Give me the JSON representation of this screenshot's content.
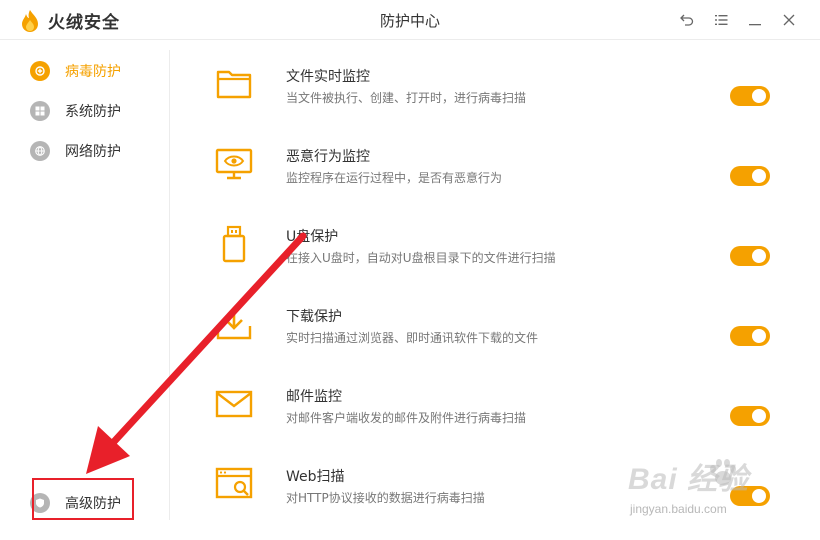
{
  "app": {
    "name": "火绒安全",
    "window_title": "防护中心"
  },
  "colors": {
    "accent": "#f5a100",
    "highlight": "#e8202a",
    "icon_gray": "#b5b5b5"
  },
  "window_buttons": [
    {
      "icon": "undo-icon"
    },
    {
      "icon": "menu-icon"
    },
    {
      "icon": "minimize-icon"
    },
    {
      "icon": "close-icon"
    }
  ],
  "sidebar": {
    "items": [
      {
        "label": "病毒防护",
        "icon": "virus-protection-icon",
        "active": true
      },
      {
        "label": "系统防护",
        "icon": "windows-icon",
        "active": false
      },
      {
        "label": "网络防护",
        "icon": "network-icon",
        "active": false
      }
    ],
    "bottom_item": {
      "label": "高级防护",
      "icon": "shield-icon"
    }
  },
  "features": [
    {
      "title": "文件实时监控",
      "desc": "当文件被执行、创建、打开时，进行病毒扫描",
      "icon": "folder-icon",
      "enabled": true
    },
    {
      "title": "恶意行为监控",
      "desc": "监控程序在运行过程中，是否有恶意行为",
      "icon": "monitor-eye-icon",
      "enabled": true
    },
    {
      "title": "U盘保护",
      "desc": "在接入U盘时，自动对U盘根目录下的文件进行扫描",
      "icon": "usb-drive-icon",
      "enabled": true
    },
    {
      "title": "下载保护",
      "desc": "实时扫描通过浏览器、即时通讯软件下载的文件",
      "icon": "download-icon",
      "enabled": true
    },
    {
      "title": "邮件监控",
      "desc": "对邮件客户端收发的邮件及附件进行病毒扫描",
      "icon": "mail-icon",
      "enabled": true
    },
    {
      "title": "Web扫描",
      "desc": "对HTTP协议接收的数据进行病毒扫描",
      "icon": "web-scan-icon",
      "enabled": true
    }
  ],
  "watermark": {
    "text": "Bai 经验",
    "sub": "jingyan.baidu.com"
  }
}
